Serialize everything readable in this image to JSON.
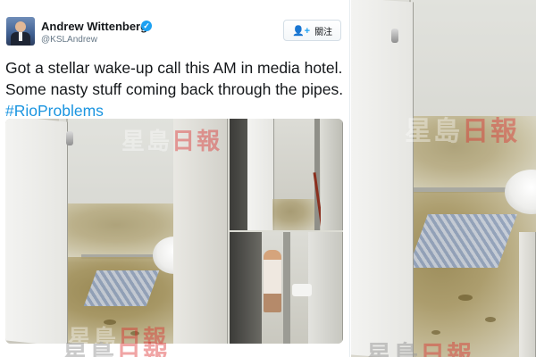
{
  "tweet": {
    "author_name": "Andrew Wittenberg",
    "verified_icon": "verified-badge-icon",
    "handle": "@KSLAndrew",
    "follow_button": {
      "label": "關注",
      "icon": "add-user-icon"
    },
    "text": "Got a stellar wake-up call this AM in media hotel. Some nasty stuff coming back through the pipes. ",
    "hashtag": "#RioProblems",
    "media": {
      "images": [
        "bathroom-floor-sewage-photo",
        "shower-stall-photo",
        "cleaning-worker-photo"
      ]
    }
  },
  "colors": {
    "hashtag": "#1b95e0",
    "verified": "#1da1f2",
    "name": "#14171a",
    "handle": "#657786"
  }
}
